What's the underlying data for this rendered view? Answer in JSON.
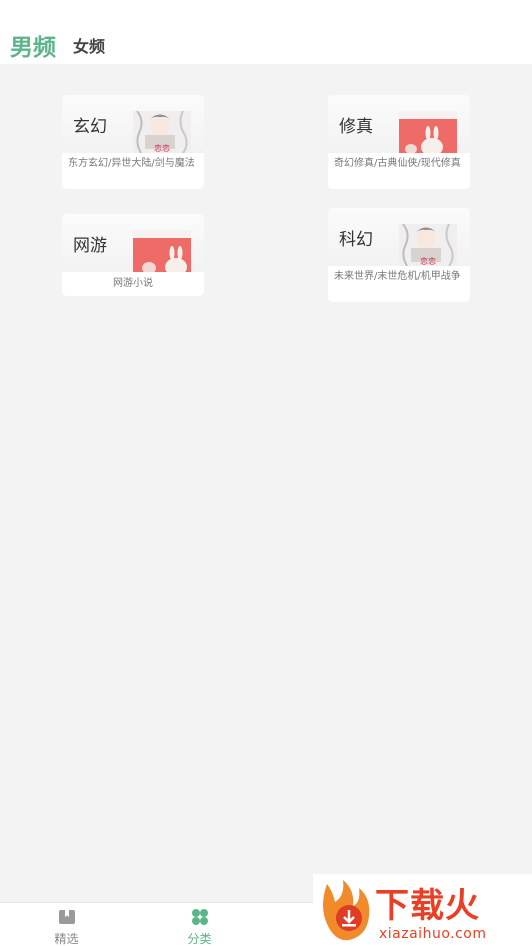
{
  "header": {
    "tabs": [
      {
        "label": "男频",
        "active": true
      },
      {
        "label": "女频",
        "active": false
      }
    ]
  },
  "categories": [
    {
      "title": "玄幻",
      "desc": "东方玄幻/异世大陆/剑与魔法",
      "cover": "portrait-cover"
    },
    {
      "title": "修真",
      "desc": "奇幻修真/古典仙侠/现代修真",
      "cover": "rabbit-cover"
    },
    {
      "title": "网游",
      "desc": "网游小说",
      "cover": "rabbit-cover"
    },
    {
      "title": "科幻",
      "desc": "未来世界/末世危机/机甲战争",
      "cover": "portrait-cover"
    }
  ],
  "tabbar": {
    "items": [
      {
        "label": "精选",
        "icon": "bookmark-icon",
        "active": false
      },
      {
        "label": "分类",
        "icon": "clover-icon",
        "active": true
      }
    ]
  },
  "watermark": {
    "brand": "下载火",
    "domain": "xiazaihuo.com",
    "icon": "flame-download-icon"
  },
  "colors": {
    "accent": "#5cb58a",
    "background": "#f3f3f3",
    "watermark": "#ea3f24",
    "cover_red": "#ee6b67"
  }
}
